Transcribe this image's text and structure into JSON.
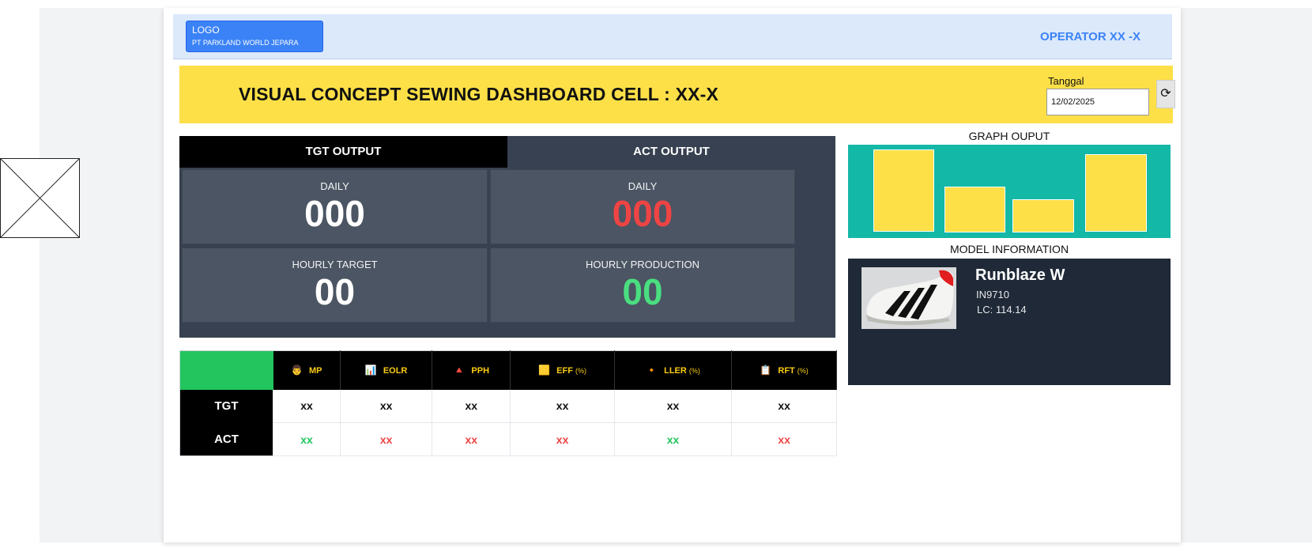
{
  "header": {
    "logo_label": "LOGO",
    "company": "PT PARKLAND WORLD JEPARA",
    "operator": "OPERATOR XX -X"
  },
  "banner": {
    "title": "VISUAL CONCEPT SEWING DASHBOARD CELL : XX-X",
    "date_label": "Tanggal",
    "date_value": "12/02/2025",
    "refresh_icon": "⟳"
  },
  "output": {
    "tgt_header": "TGT OUTPUT",
    "act_header": "ACT OUTPUT",
    "tgt_daily_label": "DAILY",
    "tgt_daily_value": "000",
    "act_daily_label": "DAILY",
    "act_daily_value": "000",
    "tgt_hourly_label": "HOURLY TARGET",
    "tgt_hourly_value": "00",
    "act_hourly_label": "HOURLY PRODUCTION",
    "act_hourly_value": "00"
  },
  "kpi": {
    "columns": [
      {
        "icon": "👨",
        "label": "MP",
        "unit": ""
      },
      {
        "icon": "📊",
        "label": "EOLR",
        "unit": ""
      },
      {
        "icon": "🔺",
        "label": "PPH",
        "unit": ""
      },
      {
        "icon": "🟨",
        "label": "EFF",
        "unit": "(%)"
      },
      {
        "icon": "🔸",
        "label": "LLER",
        "unit": "(%)"
      },
      {
        "icon": "📋",
        "label": "RFT",
        "unit": "(%)"
      }
    ],
    "rows": [
      {
        "label": "TGT",
        "values": [
          "xx",
          "xx",
          "xx",
          "xx",
          "xx",
          "xx"
        ]
      },
      {
        "label": "ACT",
        "values": [
          "xx",
          "xx",
          "xx",
          "xx",
          "xx",
          "xx"
        ]
      }
    ]
  },
  "graph": {
    "title": "GRAPH OUPUT",
    "bar_color": "#fde047",
    "bg_color": "#14b8a6"
  },
  "model": {
    "title": "MODEL INFORMATION",
    "name": "Runblaze W",
    "code": "IN9710",
    "lc": "LC: 114.14"
  }
}
